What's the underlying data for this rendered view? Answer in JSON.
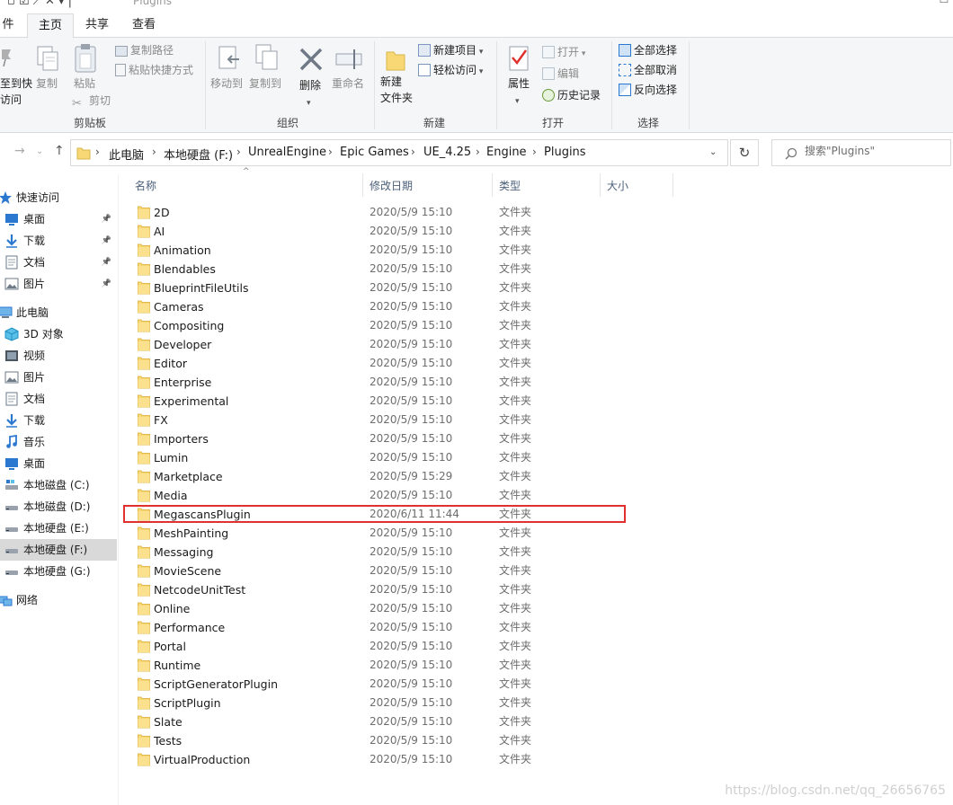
{
  "window": {
    "title": "Plugins",
    "qat_glyphs": "▫ ☑ ⟋ ✕ ▾ |"
  },
  "ribbon_tabs": [
    {
      "label": "件",
      "active": false
    },
    {
      "label": "主页",
      "active": true
    },
    {
      "label": "共享",
      "active": false
    },
    {
      "label": "查看",
      "active": false
    }
  ],
  "ribbon": {
    "clipboard": {
      "group_label": "剪贴板",
      "pin_quick_access": "至到快\n访问",
      "copy": "复制",
      "paste": "粘贴",
      "copy_path": "复制路径",
      "paste_shortcut": "粘贴快捷方式",
      "cut": "剪切"
    },
    "organize": {
      "group_label": "组织",
      "move_to": "移动到",
      "copy_to": "复制到",
      "delete": "删除",
      "rename": "重命名"
    },
    "new": {
      "group_label": "新建",
      "new_folder": "新建\n文件夹",
      "new_item": "新建项目",
      "easy_access": "轻松访问"
    },
    "open": {
      "group_label": "打开",
      "properties": "属性",
      "open": "打开",
      "edit": "编辑",
      "history": "历史记录"
    },
    "select": {
      "group_label": "选择",
      "select_all": "全部选择",
      "select_none": "全部取消",
      "invert": "反向选择"
    }
  },
  "address": {
    "crumbs": [
      "此电脑",
      "本地硬盘 (F:)",
      "UnrealEngine",
      "Epic Games",
      "UE_4.25",
      "Engine",
      "Plugins"
    ],
    "search_placeholder": "搜索\"Plugins\""
  },
  "nav": {
    "items": [
      {
        "label": "快速访问",
        "icon": "star-icon",
        "level": 0,
        "pinned": false,
        "selected": false
      },
      {
        "label": "桌面",
        "icon": "desktop-icon",
        "level": 1,
        "pinned": true,
        "selected": false
      },
      {
        "label": "下载",
        "icon": "download-icon",
        "level": 1,
        "pinned": true,
        "selected": false
      },
      {
        "label": "文档",
        "icon": "document-icon",
        "level": 1,
        "pinned": true,
        "selected": false
      },
      {
        "label": "图片",
        "icon": "picture-icon",
        "level": 1,
        "pinned": true,
        "selected": false
      },
      {
        "label": "此电脑",
        "icon": "computer-icon",
        "level": 0,
        "pinned": false,
        "selected": false
      },
      {
        "label": "3D 对象",
        "icon": "cube-icon",
        "level": 1,
        "pinned": false,
        "selected": false
      },
      {
        "label": "视频",
        "icon": "video-icon",
        "level": 1,
        "pinned": false,
        "selected": false
      },
      {
        "label": "图片",
        "icon": "picture-icon",
        "level": 1,
        "pinned": false,
        "selected": false
      },
      {
        "label": "文档",
        "icon": "document-icon",
        "level": 1,
        "pinned": false,
        "selected": false
      },
      {
        "label": "下载",
        "icon": "download-icon",
        "level": 1,
        "pinned": false,
        "selected": false
      },
      {
        "label": "音乐",
        "icon": "music-icon",
        "level": 1,
        "pinned": false,
        "selected": false
      },
      {
        "label": "桌面",
        "icon": "desktop-icon",
        "level": 1,
        "pinned": false,
        "selected": false
      },
      {
        "label": "本地磁盘 (C:)",
        "icon": "system-drive-icon",
        "level": 1,
        "pinned": false,
        "selected": false
      },
      {
        "label": "本地磁盘 (D:)",
        "icon": "drive-icon",
        "level": 1,
        "pinned": false,
        "selected": false
      },
      {
        "label": "本地硬盘 (E:)",
        "icon": "drive-icon",
        "level": 1,
        "pinned": false,
        "selected": false
      },
      {
        "label": "本地硬盘 (F:)",
        "icon": "drive-icon",
        "level": 1,
        "pinned": false,
        "selected": true
      },
      {
        "label": "本地硬盘 (G:)",
        "icon": "drive-icon",
        "level": 1,
        "pinned": false,
        "selected": false
      },
      {
        "label": "网络",
        "icon": "network-icon",
        "level": 0,
        "pinned": false,
        "selected": false
      }
    ]
  },
  "columns": {
    "name": "名称",
    "date": "修改日期",
    "type": "类型",
    "size": "大小"
  },
  "files": [
    {
      "name": "2D",
      "date": "2020/5/9 15:10",
      "type": "文件夹"
    },
    {
      "name": "AI",
      "date": "2020/5/9 15:10",
      "type": "文件夹"
    },
    {
      "name": "Animation",
      "date": "2020/5/9 15:10",
      "type": "文件夹"
    },
    {
      "name": "Blendables",
      "date": "2020/5/9 15:10",
      "type": "文件夹"
    },
    {
      "name": "BlueprintFileUtils",
      "date": "2020/5/9 15:10",
      "type": "文件夹"
    },
    {
      "name": "Cameras",
      "date": "2020/5/9 15:10",
      "type": "文件夹"
    },
    {
      "name": "Compositing",
      "date": "2020/5/9 15:10",
      "type": "文件夹"
    },
    {
      "name": "Developer",
      "date": "2020/5/9 15:10",
      "type": "文件夹"
    },
    {
      "name": "Editor",
      "date": "2020/5/9 15:10",
      "type": "文件夹"
    },
    {
      "name": "Enterprise",
      "date": "2020/5/9 15:10",
      "type": "文件夹"
    },
    {
      "name": "Experimental",
      "date": "2020/5/9 15:10",
      "type": "文件夹"
    },
    {
      "name": "FX",
      "date": "2020/5/9 15:10",
      "type": "文件夹"
    },
    {
      "name": "Importers",
      "date": "2020/5/9 15:10",
      "type": "文件夹"
    },
    {
      "name": "Lumin",
      "date": "2020/5/9 15:10",
      "type": "文件夹"
    },
    {
      "name": "Marketplace",
      "date": "2020/5/9 15:29",
      "type": "文件夹"
    },
    {
      "name": "Media",
      "date": "2020/5/9 15:10",
      "type": "文件夹"
    },
    {
      "name": "MegascansPlugin",
      "date": "2020/6/11 11:44",
      "type": "文件夹",
      "highlighted": true
    },
    {
      "name": "MeshPainting",
      "date": "2020/5/9 15:10",
      "type": "文件夹"
    },
    {
      "name": "Messaging",
      "date": "2020/5/9 15:10",
      "type": "文件夹"
    },
    {
      "name": "MovieScene",
      "date": "2020/5/9 15:10",
      "type": "文件夹"
    },
    {
      "name": "NetcodeUnitTest",
      "date": "2020/5/9 15:10",
      "type": "文件夹"
    },
    {
      "name": "Online",
      "date": "2020/5/9 15:10",
      "type": "文件夹"
    },
    {
      "name": "Performance",
      "date": "2020/5/9 15:10",
      "type": "文件夹"
    },
    {
      "name": "Portal",
      "date": "2020/5/9 15:10",
      "type": "文件夹"
    },
    {
      "name": "Runtime",
      "date": "2020/5/9 15:10",
      "type": "文件夹"
    },
    {
      "name": "ScriptGeneratorPlugin",
      "date": "2020/5/9 15:10",
      "type": "文件夹"
    },
    {
      "name": "ScriptPlugin",
      "date": "2020/5/9 15:10",
      "type": "文件夹"
    },
    {
      "name": "Slate",
      "date": "2020/5/9 15:10",
      "type": "文件夹"
    },
    {
      "name": "Tests",
      "date": "2020/5/9 15:10",
      "type": "文件夹"
    },
    {
      "name": "VirtualProduction",
      "date": "2020/5/9 15:10",
      "type": "文件夹"
    }
  ],
  "watermark": "https://blog.csdn.net/qq_26656765",
  "colors": {
    "highlight_border": "#e0312e",
    "folder_yellow": "#f8d775",
    "accent_blue": "#2b78d0",
    "selected_nav": "#d9d9d9"
  }
}
